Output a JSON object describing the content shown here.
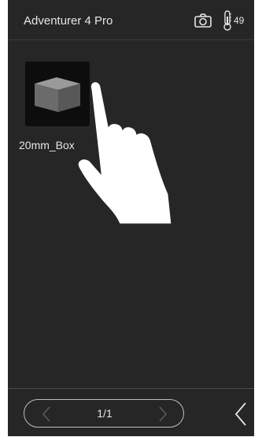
{
  "header": {
    "title": "Adventurer 4 Pro",
    "camera_icon": "camera-icon",
    "thermometer_icon": "thermometer-icon",
    "temperature": "49"
  },
  "files": [
    {
      "name": "20mm_Box",
      "thumbnail_icon": "cube-icon"
    }
  ],
  "gesture_hint": "tap-hand-icon",
  "pager": {
    "prev_icon": "chevron-left-icon",
    "next_icon": "chevron-right-icon",
    "page": "1/1"
  },
  "footer": {
    "back_icon": "back-chevron-icon"
  }
}
